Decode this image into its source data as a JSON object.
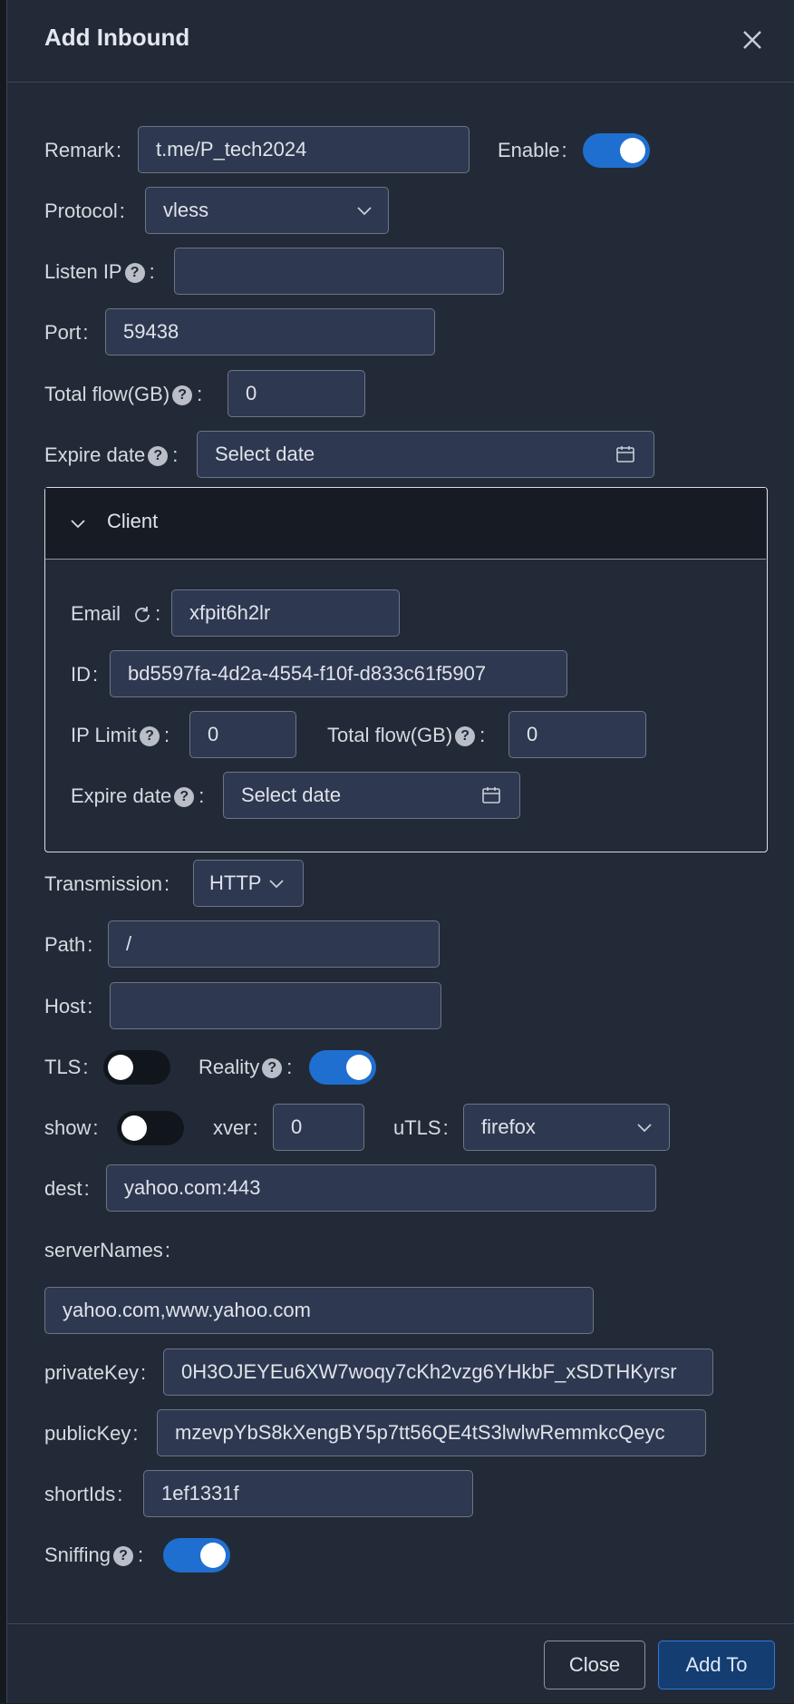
{
  "modal": {
    "title": "Add Inbound"
  },
  "fields": {
    "remark": {
      "label": "Remark",
      "value": "t.me/P_tech2024"
    },
    "enable": {
      "label": "Enable",
      "on": true
    },
    "protocol": {
      "label": "Protocol",
      "value": "vless"
    },
    "listen_ip": {
      "label": "Listen IP",
      "value": ""
    },
    "port": {
      "label": "Port",
      "value": "59438"
    },
    "total_flow": {
      "label": "Total flow(GB)",
      "value": "0"
    },
    "expire_date": {
      "label": "Expire date",
      "placeholder": "Select date"
    }
  },
  "client": {
    "header": "Client",
    "email": {
      "label": "Email",
      "value": "xfpit6h2lr"
    },
    "id": {
      "label": "ID",
      "value": "bd5597fa-4d2a-4554-f10f-d833c61f5907"
    },
    "ip_limit": {
      "label": "IP Limit",
      "value": "0"
    },
    "total_flow": {
      "label": "Total flow(GB)",
      "value": "0"
    },
    "expire_date": {
      "label": "Expire date",
      "placeholder": "Select date"
    }
  },
  "transport": {
    "transmission": {
      "label": "Transmission",
      "value": "HTTP"
    },
    "path": {
      "label": "Path",
      "value": "/"
    },
    "host": {
      "label": "Host",
      "value": ""
    },
    "tls": {
      "label": "TLS",
      "on": false
    },
    "reality": {
      "label": "Reality",
      "on": true
    },
    "show": {
      "label": "show",
      "on": false
    },
    "xver": {
      "label": "xver",
      "value": "0"
    },
    "utls": {
      "label": "uTLS",
      "value": "firefox"
    },
    "dest": {
      "label": "dest",
      "value": "yahoo.com:443"
    },
    "server_names": {
      "label": "serverNames",
      "value": "yahoo.com,www.yahoo.com"
    },
    "private_key": {
      "label": "privateKey",
      "value": "0H3OJEYEu6XW7woqy7cKh2vzg6YHkbF_xSDTHKyrsr"
    },
    "public_key": {
      "label": "publicKey",
      "value": "mzevpYbS8kXengBY5p7tt56QE4tS3lwlwRemmkcQeyc"
    },
    "short_ids": {
      "label": "shortIds",
      "value": "1ef1331f"
    },
    "sniffing": {
      "label": "Sniffing",
      "on": true
    }
  },
  "footer": {
    "close_label": "Close",
    "add_label": "Add To"
  },
  "colors": {
    "accent": "#1f6fd0",
    "panel": "#232a37",
    "input": "#2e3850"
  }
}
